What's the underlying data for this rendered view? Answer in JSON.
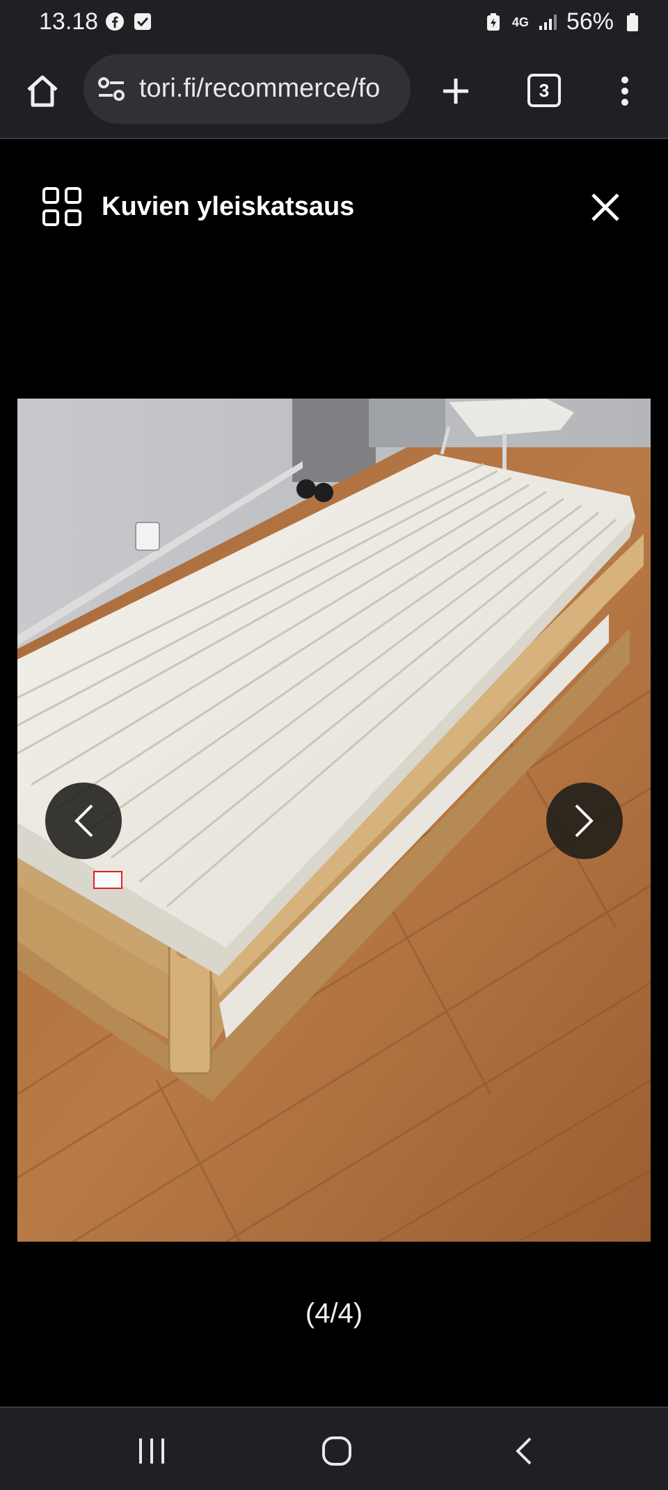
{
  "status_bar": {
    "time": "13.18",
    "left_icons": [
      "facebook-icon",
      "checkbox-notification-icon"
    ],
    "network": "4G",
    "battery": "56%"
  },
  "browser": {
    "url": "tori.fi/recommerce/fo",
    "tab_count": "3"
  },
  "viewer": {
    "title": "Kuvien yleiskatsaus",
    "counter": "(4/4)"
  },
  "icons": [
    "home-icon",
    "site-settings-icon",
    "plus-icon",
    "tab-switcher-icon",
    "more-vert-icon",
    "grid-icon",
    "close-icon",
    "chevron-left-icon",
    "chevron-right-icon",
    "recent-apps-icon",
    "home-circle-icon",
    "back-icon"
  ],
  "colors": {
    "chrome_bg": "#1f2024",
    "url_pill": "#303137",
    "viewer_bg": "#000000"
  }
}
